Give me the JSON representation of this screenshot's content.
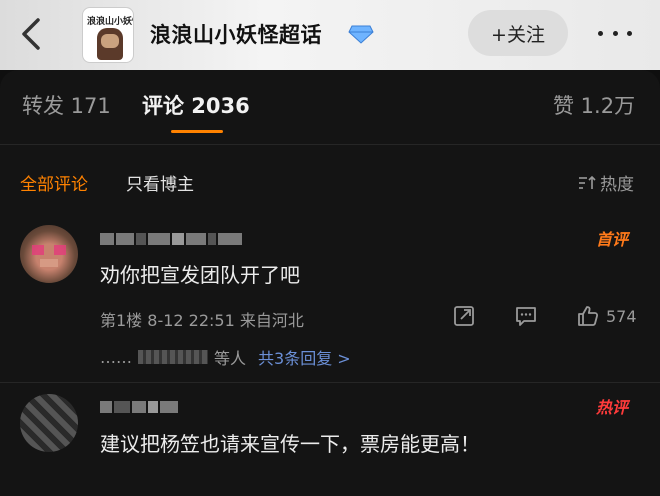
{
  "header": {
    "title": "浪浪山小妖怪超话",
    "avatar_text": "浪浪山小妖怪",
    "follow_label": "+关注"
  },
  "tabs": [
    {
      "label": "转发 171"
    },
    {
      "label": "评论 2036"
    },
    {
      "label": "赞 1.2万"
    }
  ],
  "filters": {
    "all": "全部评论",
    "blogger": "只看博主",
    "sort": "热度"
  },
  "comments": [
    {
      "badge": "首评",
      "text": "劝你把宣发团队开了吧",
      "meta": "第1楼  8-12 22:51  来自河北",
      "likes": "574",
      "replies_prefix": "……",
      "replies_mid": "等人",
      "replies_link": "共3条回复 >"
    },
    {
      "badge": "热评",
      "text": "建议把杨笠也请来宣传一下，票房能更高！"
    }
  ],
  "colors": {
    "accent": "#ff8200",
    "link": "#6b8fd6",
    "background": "#141414"
  }
}
